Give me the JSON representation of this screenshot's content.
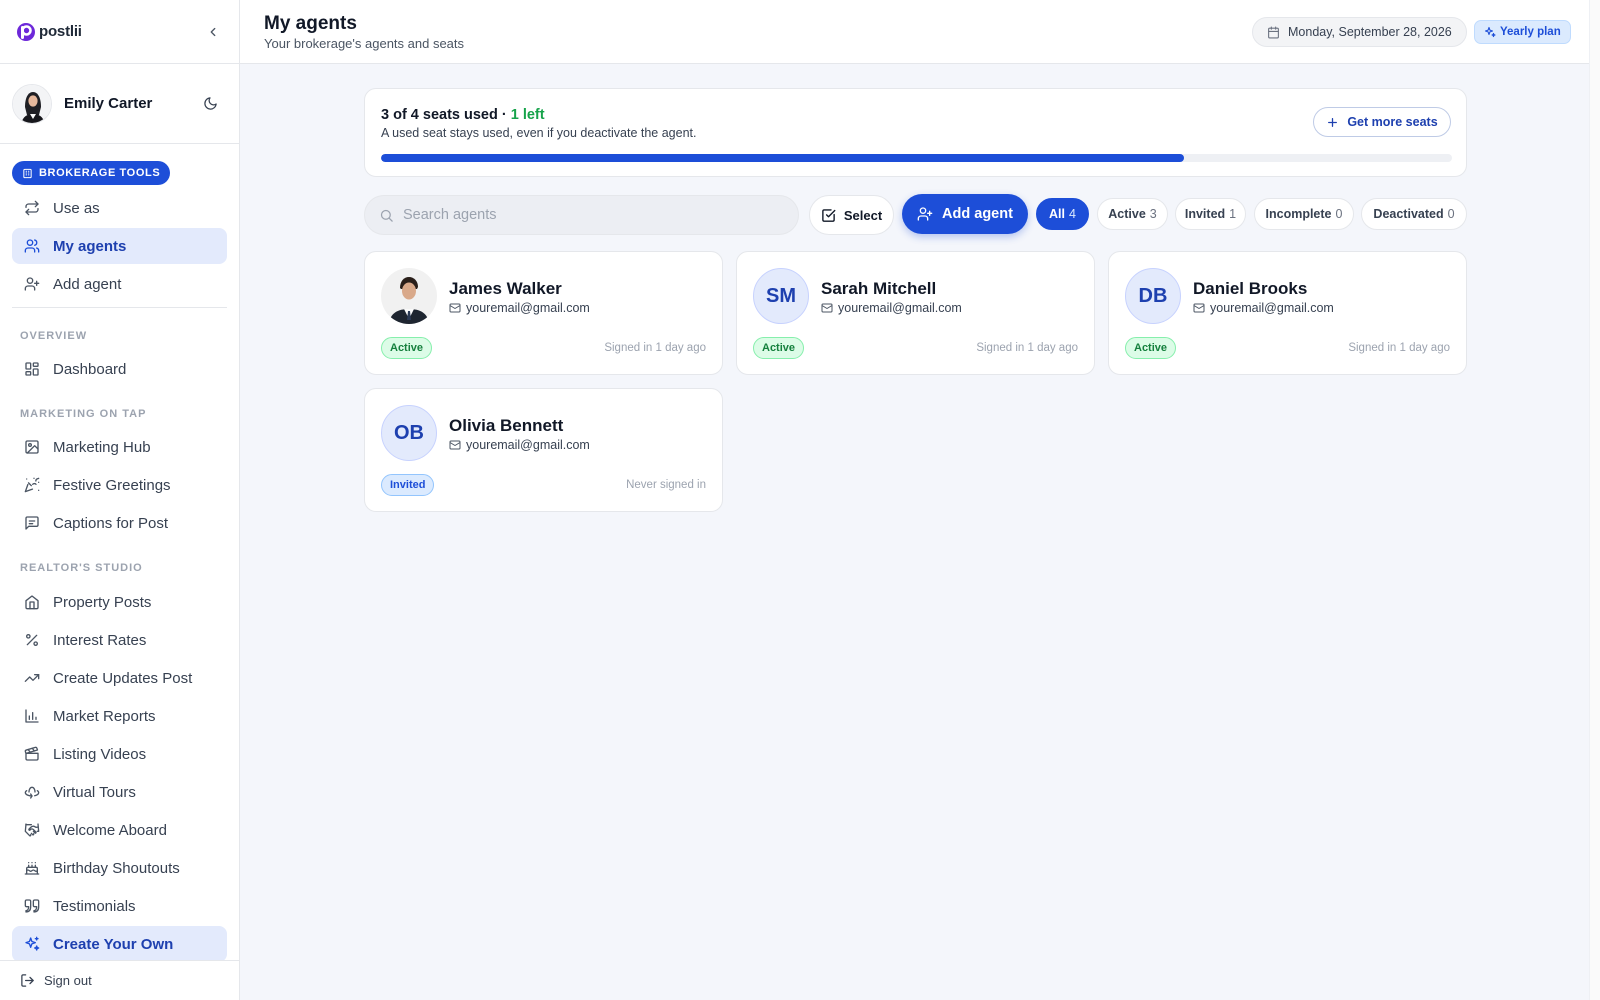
{
  "app": {
    "name": "postlii"
  },
  "user": {
    "name": "Emily Carter"
  },
  "sidebar": {
    "brokerage_badge": "BROKERAGE TOOLS",
    "brokerage_items": [
      {
        "label": "Use as",
        "icon": "switch-icon"
      },
      {
        "label": "My agents",
        "icon": "users-icon",
        "active": true
      },
      {
        "label": "Add agent",
        "icon": "user-plus-icon"
      }
    ],
    "sections": [
      {
        "title": "OVERVIEW",
        "items": [
          {
            "label": "Dashboard",
            "icon": "dashboard-icon"
          }
        ]
      },
      {
        "title": "MARKETING ON TAP",
        "items": [
          {
            "label": "Marketing Hub",
            "icon": "image-icon"
          },
          {
            "label": "Festive Greetings",
            "icon": "party-icon"
          },
          {
            "label": "Captions for Post",
            "icon": "message-icon"
          }
        ]
      },
      {
        "title": "REALTOR'S STUDIO",
        "items": [
          {
            "label": "Property Posts",
            "icon": "home-icon"
          },
          {
            "label": "Interest Rates",
            "icon": "percent-icon"
          },
          {
            "label": "Create Updates Post",
            "icon": "trending-icon"
          },
          {
            "label": "Market Reports",
            "icon": "bar-chart-icon"
          },
          {
            "label": "Listing Videos",
            "icon": "clapperboard-icon"
          },
          {
            "label": "Virtual Tours",
            "icon": "rotate-3d-icon"
          },
          {
            "label": "Welcome Aboard",
            "icon": "handshake-icon"
          },
          {
            "label": "Birthday Shoutouts",
            "icon": "cake-icon"
          },
          {
            "label": "Testimonials",
            "icon": "quote-icon"
          },
          {
            "label": "Create Your Own",
            "icon": "sparkles-icon",
            "active": true
          }
        ]
      }
    ],
    "sign_out": "Sign out"
  },
  "header": {
    "title": "My agents",
    "subtitle": "Your brokerage's agents and seats",
    "date": "Monday, September 28, 2026",
    "plan": "Yearly plan"
  },
  "seats": {
    "used_text": "3 of 4 seats used · ",
    "left_text": "1 left",
    "note": "A used seat stays used, even if you deactivate the agent.",
    "more_button": "Get more seats",
    "used": 3,
    "total": 4,
    "fill_fraction": 0.75
  },
  "toolbar": {
    "search_placeholder": "Search agents",
    "select_label": "Select",
    "add_label": "Add agent",
    "filters": [
      {
        "label": "All",
        "count": "4",
        "active": true
      },
      {
        "label": "Active",
        "count": "3"
      },
      {
        "label": "Invited",
        "count": "1"
      },
      {
        "label": "Incomplete",
        "count": "0"
      },
      {
        "label": "Deactivated",
        "count": "0"
      }
    ]
  },
  "agents": [
    {
      "name": "James Walker",
      "email": "youremail@gmail.com",
      "status": "Active",
      "last_signin": "Signed in 1 day ago",
      "initials": ""
    },
    {
      "name": "Sarah Mitchell",
      "email": "youremail@gmail.com",
      "status": "Active",
      "last_signin": "Signed in 1 day ago",
      "initials": "SM"
    },
    {
      "name": "Daniel Brooks",
      "email": "youremail@gmail.com",
      "status": "Active",
      "last_signin": "Signed in 1 day ago",
      "initials": "DB"
    },
    {
      "name": "Olivia Bennett",
      "email": "youremail@gmail.com",
      "status": "Invited",
      "last_signin": "Never signed in",
      "initials": "OB"
    }
  ],
  "colors": {
    "accent": "#1d4ed8",
    "active_nav_bg": "#e3eafc",
    "success": "#16a34a",
    "page_bg": "#f4f6fb"
  }
}
